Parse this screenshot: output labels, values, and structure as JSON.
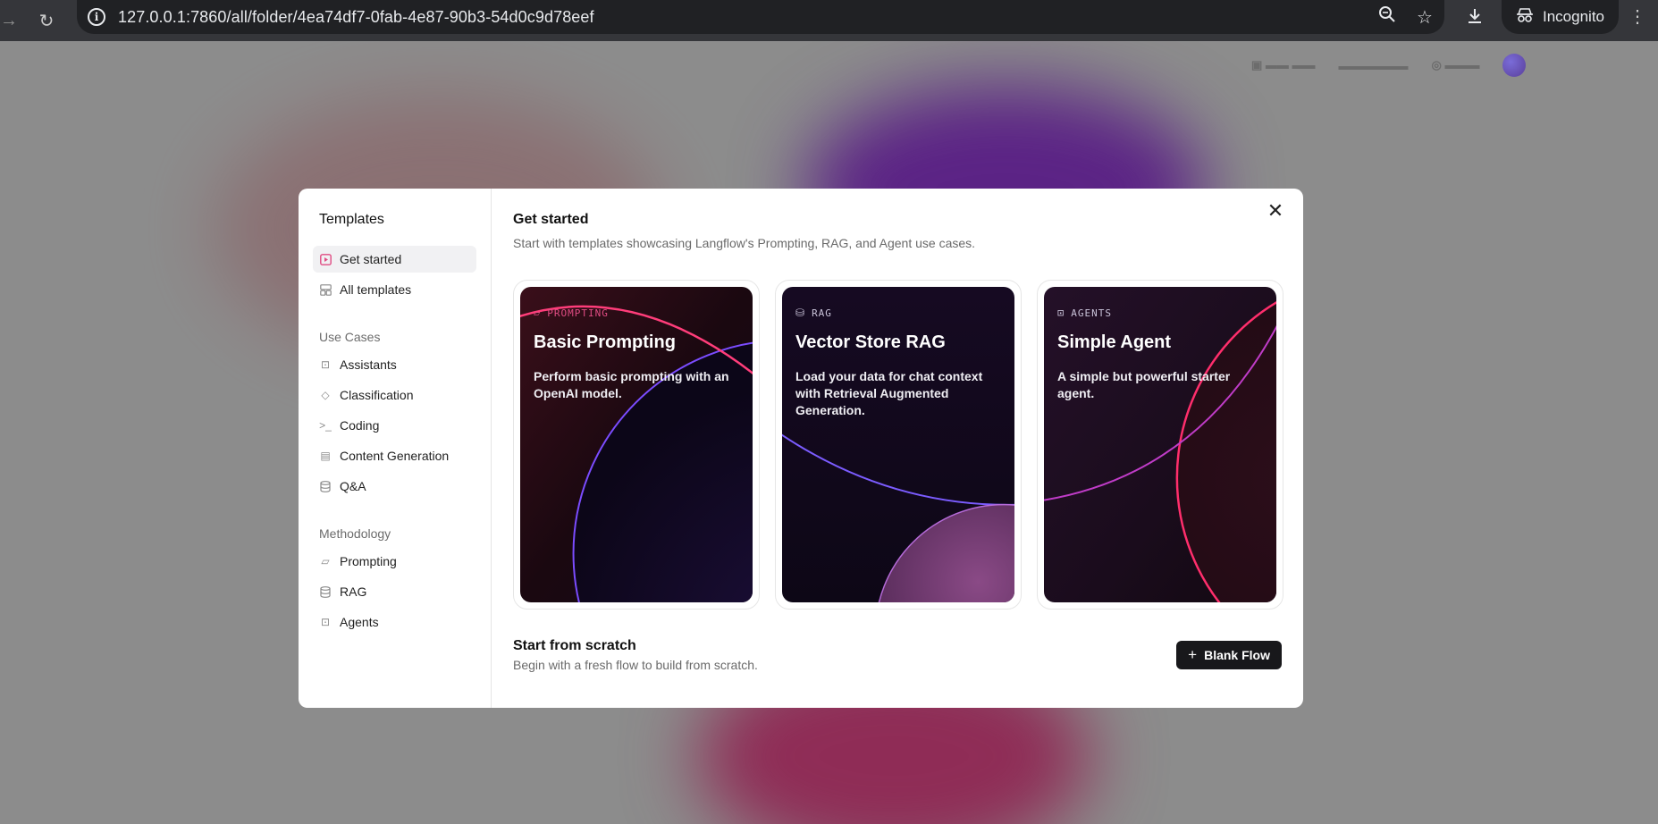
{
  "browser": {
    "url": "127.0.0.1:7860/all/folder/4ea74df7-0fab-4e87-90b3-54d0c9d78eef",
    "profile_label": "Incognito",
    "icons": [
      "back-icon",
      "reload-icon",
      "info-icon",
      "zoom-icon",
      "star-icon",
      "download-icon",
      "incognito-icon",
      "menu-icon"
    ]
  },
  "modal": {
    "sidebar": {
      "title": "Templates",
      "items": [
        {
          "label": "Get started",
          "icon": "play-icon",
          "active": true
        },
        {
          "label": "All templates",
          "icon": "grid-icon"
        }
      ],
      "groups": [
        {
          "label": "Use Cases",
          "items": [
            {
              "label": "Assistants",
              "icon": "bot-icon"
            },
            {
              "label": "Classification",
              "icon": "tags-icon"
            },
            {
              "label": "Coding",
              "icon": "terminal-icon"
            },
            {
              "label": "Content Generation",
              "icon": "newspaper-icon"
            },
            {
              "label": "Q&A",
              "icon": "database-icon"
            }
          ]
        },
        {
          "label": "Methodology",
          "items": [
            {
              "label": "Prompting",
              "icon": "messages-icon"
            },
            {
              "label": "RAG",
              "icon": "database-icon"
            },
            {
              "label": "Agents",
              "icon": "bot-icon"
            }
          ]
        }
      ]
    },
    "main": {
      "title": "Get started",
      "subtitle": "Start with templates showcasing Langflow's Prompting, RAG, and Agent use cases.",
      "cards": [
        {
          "tag": "PROMPTING",
          "icon": "messages-icon",
          "title": "Basic Prompting",
          "description": "Perform basic prompting with an OpenAI model."
        },
        {
          "tag": "RAG",
          "icon": "database-icon",
          "title": "Vector Store RAG",
          "description": "Load your data for chat context with Retrieval Augmented Generation."
        },
        {
          "tag": "AGENTS",
          "icon": "bot-icon",
          "title": "Simple Agent",
          "description": "A simple but powerful starter agent."
        }
      ],
      "scratch": {
        "title": "Start from scratch",
        "subtitle": "Begin with a fresh flow to build from scratch.",
        "button_label": "Blank Flow"
      }
    }
  },
  "colors": {
    "accent": "#e04c83",
    "button_bg": "#18181b",
    "chrome_bg": "#35363a"
  }
}
